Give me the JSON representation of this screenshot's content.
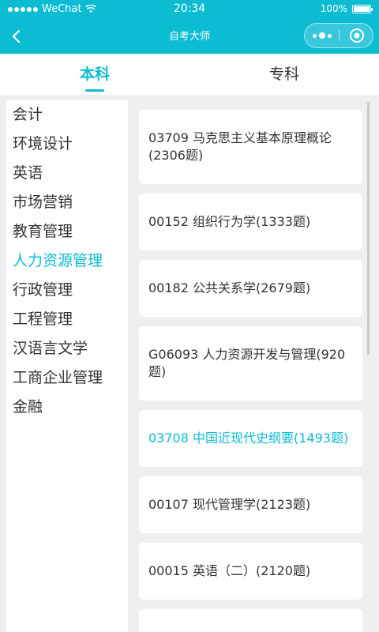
{
  "status_bar": {
    "carrier": "WeChat",
    "time": "20:34",
    "battery": "100%",
    "battery_level": 1.0
  },
  "nav": {
    "title": "自考大师",
    "back_icon": "chevron-left-icon",
    "more_icon": "more-dots-icon",
    "close_icon": "target-circle-icon"
  },
  "tabs": [
    {
      "label": "本科",
      "active": true
    },
    {
      "label": "专科",
      "active": false
    }
  ],
  "sidebar": {
    "items": [
      {
        "label": "会计"
      },
      {
        "label": "环境设计"
      },
      {
        "label": "英语"
      },
      {
        "label": "市场营销"
      },
      {
        "label": "教育管理"
      },
      {
        "label": "人力资源管理",
        "active": true
      },
      {
        "label": "行政管理"
      },
      {
        "label": "工程管理"
      },
      {
        "label": "汉语言文学"
      },
      {
        "label": "工商企业管理"
      },
      {
        "label": "金融"
      }
    ]
  },
  "courses": [
    {
      "label": "03709 马克思主义基本原理概论(2306题)"
    },
    {
      "label": "00152 组织行为学(1333题)"
    },
    {
      "label": "00182 公共关系学(2679题)"
    },
    {
      "label": "G06093 人力资源开发与管理(920题)"
    },
    {
      "label": "03708 中国近现代史纲要(1493题)",
      "active": true
    },
    {
      "label": "00107 现代管理学(2123题)"
    },
    {
      "label": "00015 英语（二）(2120题)"
    },
    {
      "label": ""
    }
  ],
  "colors": {
    "accent": "#0bbcd3",
    "text": "#333333",
    "background": "#efeff1"
  }
}
